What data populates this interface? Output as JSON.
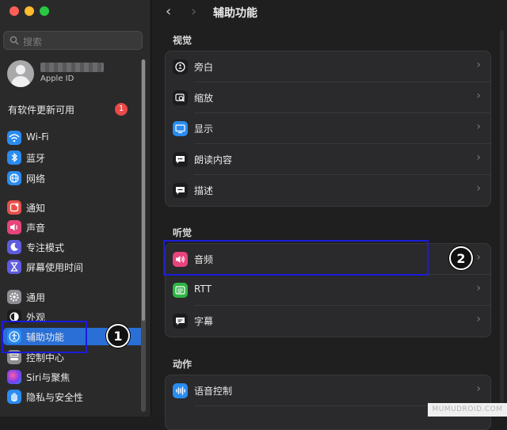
{
  "window": {
    "title": "辅助功能"
  },
  "sidebar": {
    "search_placeholder": "搜索",
    "account": {
      "name_blurred": "",
      "subtitle": "Apple ID"
    },
    "update": {
      "label": "有软件更新可用",
      "badge": "1"
    },
    "items": [
      {
        "label": "Wi-Fi",
        "icon": "wifi-icon",
        "color": "#2a8cf0"
      },
      {
        "label": "蓝牙",
        "icon": "bluetooth-icon",
        "color": "#2a8cf0"
      },
      {
        "label": "网络",
        "icon": "globe-icon",
        "color": "#2a8cf0"
      },
      {
        "label": "通知",
        "icon": "bell-icon",
        "color": "#e8504a"
      },
      {
        "label": "声音",
        "icon": "speaker-icon",
        "color": "#e8437d"
      },
      {
        "label": "专注模式",
        "icon": "moon-icon",
        "color": "#5f5ce0"
      },
      {
        "label": "屏幕使用时间",
        "icon": "hourglass-icon",
        "color": "#5f5ce0"
      },
      {
        "label": "通用",
        "icon": "gear-icon",
        "color": "#8e8e93"
      },
      {
        "label": "外观",
        "icon": "appearance-icon",
        "color": "#1c1c1e"
      },
      {
        "label": "辅助功能",
        "icon": "accessibility-icon",
        "color": "#2a8cf0",
        "active": true
      },
      {
        "label": "控制中心",
        "icon": "control-center-icon",
        "color": "#8e8e93"
      },
      {
        "label": "Siri与聚焦",
        "icon": "siri-icon",
        "color": "#b144d8"
      },
      {
        "label": "隐私与安全性",
        "icon": "hand-icon",
        "color": "#2a8cf0"
      }
    ]
  },
  "main": {
    "back": "‹",
    "forward": "›",
    "sections": [
      {
        "header": "视觉",
        "rows": [
          {
            "label": "旁白",
            "icon": "voiceover-icon"
          },
          {
            "label": "缩放",
            "icon": "zoom-icon"
          },
          {
            "label": "显示",
            "icon": "display-icon"
          },
          {
            "label": "朗读内容",
            "icon": "spoken-content-icon"
          },
          {
            "label": "描述",
            "icon": "descriptions-icon"
          }
        ]
      },
      {
        "header": "听觉",
        "rows": [
          {
            "label": "音频",
            "icon": "audio-icon"
          },
          {
            "label": "RTT",
            "icon": "rtt-icon"
          },
          {
            "label": "字幕",
            "icon": "captions-icon"
          }
        ]
      },
      {
        "header": "动作",
        "rows": [
          {
            "label": "语音控制",
            "icon": "voice-control-icon"
          }
        ]
      }
    ]
  },
  "annotations": {
    "step1": "1",
    "step2": "2"
  },
  "watermark": "MUMUDROID.COM"
}
